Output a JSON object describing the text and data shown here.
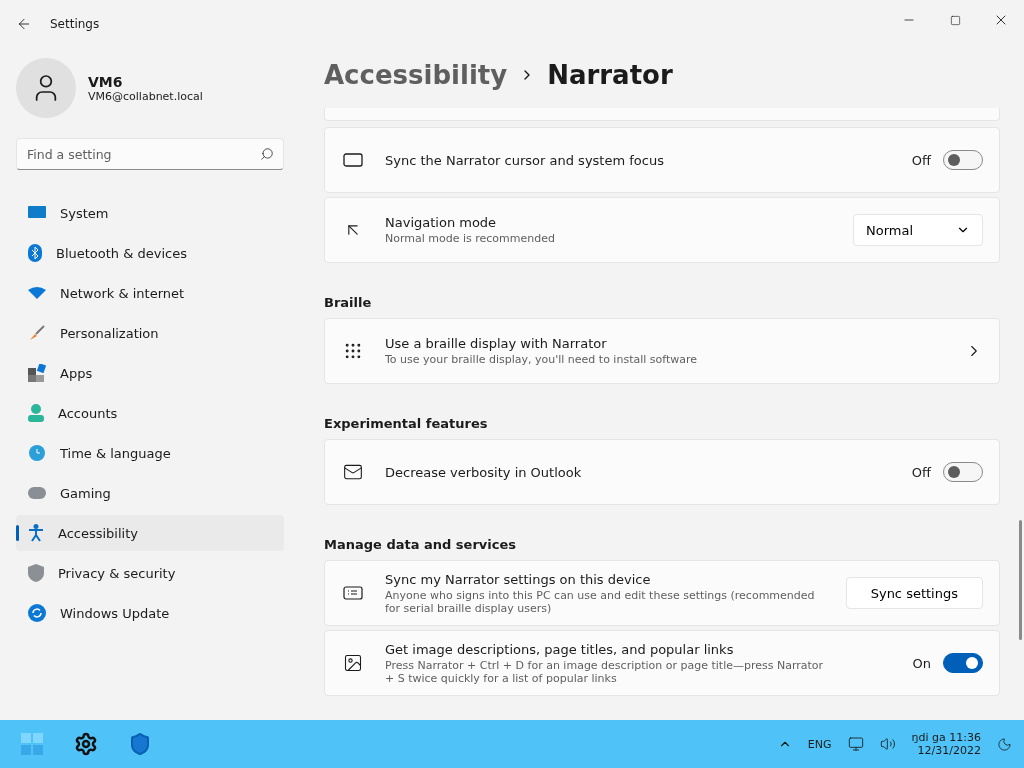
{
  "window": {
    "title": "Settings"
  },
  "user": {
    "name": "VM6",
    "email": "VM6@collabnet.local"
  },
  "search": {
    "placeholder": "Find a setting"
  },
  "sidebar": {
    "items": [
      {
        "label": "System",
        "selected": false
      },
      {
        "label": "Bluetooth & devices",
        "selected": false
      },
      {
        "label": "Network & internet",
        "selected": false
      },
      {
        "label": "Personalization",
        "selected": false
      },
      {
        "label": "Apps",
        "selected": false
      },
      {
        "label": "Accounts",
        "selected": false
      },
      {
        "label": "Time & language",
        "selected": false
      },
      {
        "label": "Gaming",
        "selected": false
      },
      {
        "label": "Accessibility",
        "selected": true
      },
      {
        "label": "Privacy & security",
        "selected": false
      },
      {
        "label": "Windows Update",
        "selected": false
      }
    ]
  },
  "breadcrumb": [
    "Accessibility",
    "Narrator"
  ],
  "sections": [
    {
      "rows": [
        {
          "kind": "toggle",
          "title": "Sync the Narrator cursor and system focus",
          "state_label": "Off",
          "on": false
        },
        {
          "kind": "dropdown",
          "title": "Navigation mode",
          "description": "Normal mode is recommended",
          "value": "Normal"
        }
      ]
    },
    {
      "heading": "Braille",
      "rows": [
        {
          "kind": "link",
          "title": "Use a braille display with Narrator",
          "description": "To use your braille display, you'll need to install software"
        }
      ]
    },
    {
      "heading": "Experimental features",
      "rows": [
        {
          "kind": "toggle",
          "title": "Decrease verbosity in Outlook",
          "state_label": "Off",
          "on": false
        }
      ]
    },
    {
      "heading": "Manage data and services",
      "rows": [
        {
          "kind": "button",
          "title": "Sync my Narrator settings on this device",
          "description": "Anyone who signs into this PC can use and edit these settings (recommended for serial braille display users)",
          "button": "Sync settings"
        },
        {
          "kind": "toggle",
          "title": "Get image descriptions, page titles, and popular links",
          "description": "Press Narrator + Ctrl + D for an image description or page title—press Narrator + S twice quickly for a list of popular links",
          "state_label": "On",
          "on": true
        }
      ]
    }
  ],
  "taskbar": {
    "language": "ENG",
    "time": "ŋdi ga 11:36",
    "date": "12/31/2022"
  }
}
